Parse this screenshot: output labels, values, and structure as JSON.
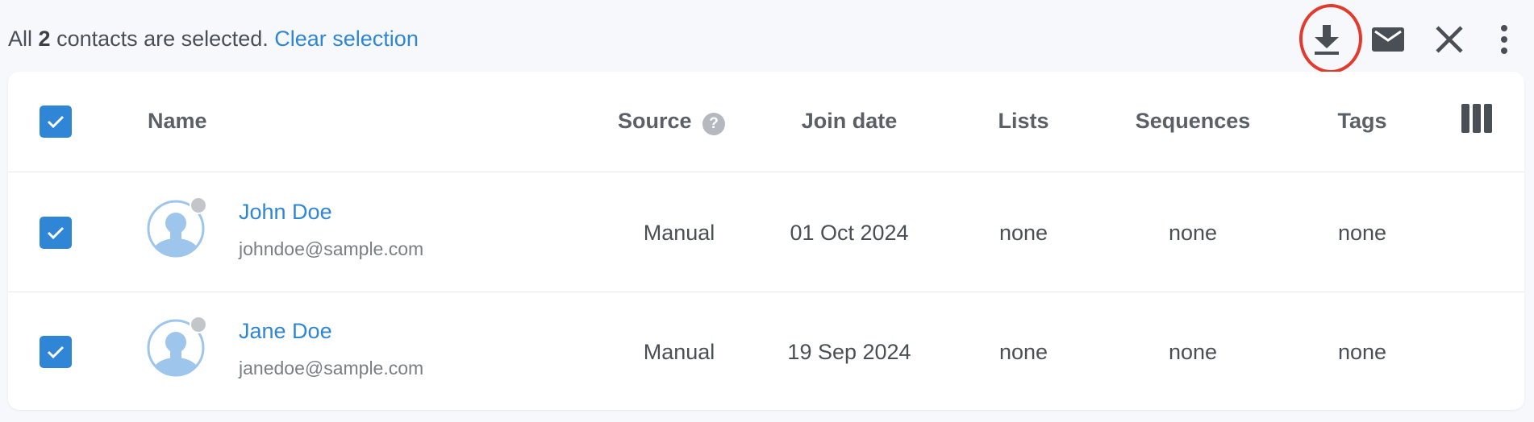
{
  "selection": {
    "prefix": "All",
    "count": "2",
    "suffix": "contacts are selected.",
    "clear_label": "Clear selection"
  },
  "toolbar": {
    "icons": [
      "download-icon",
      "email-icon",
      "close-icon",
      "more-vert-icon"
    ],
    "highlighted": "download-icon",
    "highlight_color": "#e23b2e"
  },
  "table": {
    "columns": {
      "name": "Name",
      "source": "Source",
      "join_date": "Join date",
      "lists": "Lists",
      "sequences": "Sequences",
      "tags": "Tags"
    },
    "source_help": "?",
    "rows": [
      {
        "name": "John Doe",
        "email": "johndoe@sample.com",
        "source": "Manual",
        "join_date": "01 Oct 2024",
        "lists": "none",
        "sequences": "none",
        "tags": "none",
        "selected": true
      },
      {
        "name": "Jane Doe",
        "email": "janedoe@sample.com",
        "source": "Manual",
        "join_date": "19 Sep 2024",
        "lists": "none",
        "sequences": "none",
        "tags": "none",
        "selected": true
      }
    ]
  },
  "colors": {
    "accent": "#2f86d6",
    "background": "#f7f8fc",
    "avatar_fill": "#9ec5ec",
    "status_dot": "#c2c5ca"
  }
}
